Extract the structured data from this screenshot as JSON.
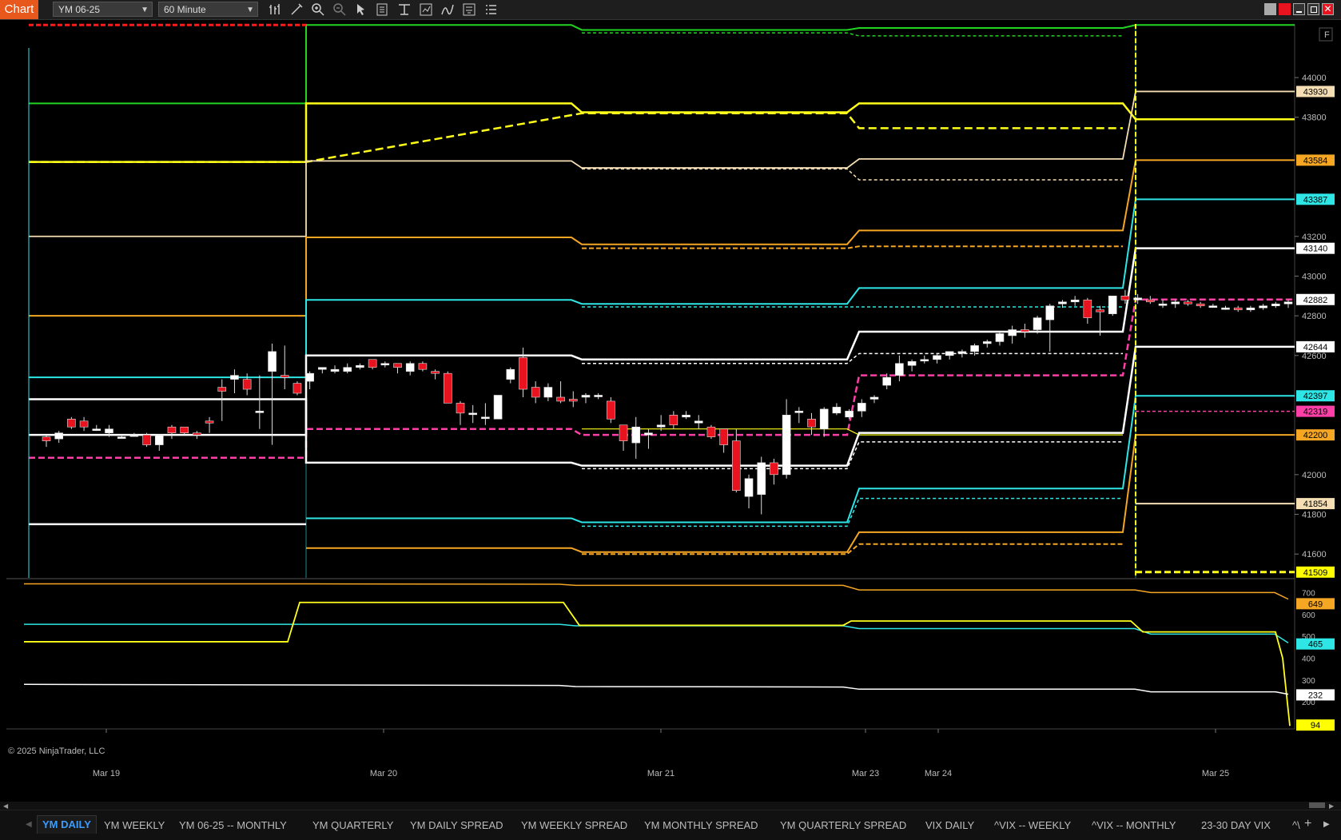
{
  "toolbar": {
    "title": "Chart",
    "instrument": "YM 06-25",
    "interval": "60 Minute",
    "icons": [
      "bars-type-icon",
      "draw-icon",
      "zoom-in-icon",
      "zoom-out-icon",
      "pointer-icon",
      "data-box-icon",
      "templates-icon",
      "properties-icon",
      "indicators-icon",
      "strategies-icon",
      "list-icon"
    ]
  },
  "window": {
    "buttons": [
      "restore-icon",
      "color-icon",
      "minimize-icon",
      "maximize-icon",
      "close-icon"
    ]
  },
  "price_axis": {
    "ticks": [
      "44000",
      "43800",
      "43200",
      "43000",
      "42800",
      "42600",
      "42000",
      "41800",
      "41600"
    ],
    "flag": "F",
    "markers": [
      {
        "text": "43930",
        "color": "#f5deb3"
      },
      {
        "text": "43584",
        "color": "#f5a623"
      },
      {
        "text": "43387",
        "color": "#2ee6e6"
      },
      {
        "text": "43140",
        "color": "#ffffff"
      },
      {
        "text": "42882",
        "color": "#ffffff"
      },
      {
        "text": "42644",
        "color": "#ffffff"
      },
      {
        "text": "42397",
        "color": "#2ee6e6"
      },
      {
        "text": "42319",
        "color": "#ff3fa8"
      },
      {
        "text": "42200",
        "color": "#f5a623"
      },
      {
        "text": "41854",
        "color": "#f5deb3"
      },
      {
        "text": "41509",
        "color": "#ffff00"
      }
    ]
  },
  "indicator_axis": {
    "ticks": [
      "700",
      "600",
      "500",
      "400",
      "300",
      "200"
    ],
    "markers": [
      {
        "text": "649",
        "color": "#f5a623"
      },
      {
        "text": "465",
        "color": "#2ee6e6"
      },
      {
        "text": "232",
        "color": "#ffffff"
      },
      {
        "text": "94",
        "color": "#ffff00"
      }
    ]
  },
  "time_axis": [
    "Mar 19",
    "Mar 20",
    "Mar 21",
    "Mar 23",
    "Mar 24",
    "Mar 25"
  ],
  "copyright": "© 2025 NinjaTrader, LLC",
  "tabs": [
    "YM DAILY",
    "YM WEEKLY",
    "YM 06-25 -- MONTHLY",
    "YM QUARTERLY",
    "YM DAILY SPREAD",
    "YM WEEKLY SPREAD",
    "YM MONTHLY SPREAD",
    "YM QUARTERLY SPREAD",
    "VIX DAILY",
    "^VIX -- WEEKLY",
    "^VIX -- MONTHLY",
    "23-30 DAY VIX",
    "^\\"
  ],
  "colors": {
    "bull": "#ffffff",
    "bear": "#e8131f",
    "green": "#22d422",
    "yellow": "#ffff1a",
    "tan": "#f5deb3",
    "orange": "#f5a623",
    "cyan": "#2ee6e6",
    "pink": "#ff3fa8",
    "red": "#ff1a1a"
  },
  "chart_data": {
    "type": "candlestick",
    "symbol": "YM 06-25",
    "interval": "60 Minute",
    "ylim": [
      41480,
      44270
    ],
    "candles": [
      [
        42190,
        42200,
        42140,
        42170
      ],
      [
        42180,
        42220,
        42160,
        42210
      ],
      [
        42280,
        42290,
        42230,
        42240
      ],
      [
        42270,
        42290,
        42220,
        42240
      ],
      [
        42230,
        42250,
        42220,
        42230
      ],
      [
        42210,
        42250,
        42190,
        42230
      ],
      [
        42190,
        42200,
        42180,
        42190
      ],
      [
        42200,
        42210,
        42200,
        42200
      ],
      [
        42200,
        42210,
        42140,
        42150
      ],
      [
        42150,
        42190,
        42120,
        42200
      ],
      [
        42240,
        42250,
        42180,
        42210
      ],
      [
        42240,
        42240,
        42200,
        42210
      ],
      [
        42210,
        42220,
        42180,
        42200
      ],
      [
        42270,
        42290,
        42210,
        42260
      ],
      [
        42440,
        42480,
        42270,
        42420
      ],
      [
        42480,
        42530,
        42410,
        42500
      ],
      [
        42480,
        42510,
        42400,
        42430
      ],
      [
        42320,
        42500,
        42230,
        42320
      ],
      [
        42520,
        42660,
        42150,
        42620
      ],
      [
        42500,
        42650,
        42430,
        42490
      ],
      [
        42460,
        42470,
        42400,
        42410
      ],
      [
        42470,
        42520,
        42430,
        42510
      ],
      [
        42530,
        42540,
        42510,
        42540
      ],
      [
        42520,
        42550,
        42510,
        42530
      ],
      [
        42520,
        42560,
        42510,
        42540
      ],
      [
        42540,
        42560,
        42530,
        42550
      ],
      [
        42580,
        42580,
        42530,
        42540
      ],
      [
        42560,
        42570,
        42540,
        42560
      ],
      [
        42560,
        42560,
        42510,
        42540
      ],
      [
        42520,
        42570,
        42500,
        42560
      ],
      [
        42560,
        42570,
        42520,
        42530
      ],
      [
        42520,
        42530,
        42480,
        42510
      ],
      [
        42510,
        42520,
        42460,
        42360
      ],
      [
        42360,
        42370,
        42250,
        42310
      ],
      [
        42310,
        42350,
        42260,
        42310
      ],
      [
        42290,
        42360,
        42250,
        42290
      ],
      [
        42280,
        42400,
        42280,
        42400
      ],
      [
        42480,
        42540,
        42460,
        42530
      ],
      [
        42590,
        42640,
        42390,
        42430
      ],
      [
        42440,
        42470,
        42360,
        42390
      ],
      [
        42390,
        42460,
        42370,
        42440
      ],
      [
        42390,
        42470,
        42360,
        42370
      ],
      [
        42380,
        42420,
        42340,
        42370
      ],
      [
        42390,
        42410,
        42360,
        42400
      ],
      [
        42400,
        42410,
        42380,
        42400
      ],
      [
        42370,
        42390,
        42260,
        42280
      ],
      [
        42250,
        42250,
        42120,
        42170
      ],
      [
        42160,
        42290,
        42080,
        42240
      ],
      [
        42200,
        42230,
        42130,
        42210
      ],
      [
        42240,
        42300,
        42220,
        42250
      ],
      [
        42300,
        42320,
        42230,
        42250
      ],
      [
        42290,
        42320,
        42280,
        42300
      ],
      [
        42260,
        42300,
        42230,
        42270
      ],
      [
        42240,
        42250,
        42180,
        42190
      ],
      [
        42230,
        42230,
        42110,
        42150
      ],
      [
        42170,
        42230,
        41910,
        41920
      ],
      [
        41890,
        42000,
        41830,
        41980
      ],
      [
        41900,
        42090,
        41800,
        42060
      ],
      [
        42060,
        42080,
        41950,
        42000
      ],
      [
        42000,
        42380,
        41980,
        42300
      ],
      [
        42320,
        42340,
        42260,
        42320
      ],
      [
        42280,
        42310,
        42200,
        42240
      ],
      [
        42230,
        42340,
        42190,
        42330
      ],
      [
        42310,
        42360,
        42300,
        42340
      ],
      [
        42290,
        42330,
        42280,
        42320
      ],
      [
        42320,
        42380,
        42290,
        42360
      ],
      [
        42380,
        42400,
        42360,
        42390
      ],
      [
        42450,
        42510,
        42430,
        42490
      ],
      [
        42500,
        42600,
        42470,
        42560
      ],
      [
        42550,
        42580,
        42520,
        42570
      ],
      [
        42580,
        42600,
        42560,
        42580
      ],
      [
        42580,
        42610,
        42560,
        42600
      ],
      [
        42600,
        42620,
        42580,
        42620
      ],
      [
        42610,
        42630,
        42590,
        42620
      ],
      [
        42620,
        42660,
        42600,
        42650
      ],
      [
        42660,
        42680,
        42640,
        42670
      ],
      [
        42670,
        42720,
        42650,
        42710
      ],
      [
        42700,
        42750,
        42660,
        42730
      ],
      [
        42730,
        42760,
        42690,
        42720
      ],
      [
        42730,
        42800,
        42710,
        42790
      ],
      [
        42780,
        42860,
        42620,
        42850
      ],
      [
        42860,
        42880,
        42840,
        42870
      ],
      [
        42870,
        42900,
        42850,
        42880
      ],
      [
        42880,
        42890,
        42760,
        42790
      ],
      [
        42830,
        42850,
        42700,
        42820
      ],
      [
        42810,
        42900,
        42800,
        42900
      ],
      [
        42900,
        42930,
        42860,
        42880
      ],
      [
        42880,
        42910,
        42860,
        42890
      ],
      [
        42880,
        42900,
        42860,
        42870
      ],
      [
        42860,
        42880,
        42840,
        42860
      ],
      [
        42860,
        42880,
        42840,
        42870
      ],
      [
        42870,
        42880,
        42850,
        42860
      ],
      [
        42860,
        42870,
        42840,
        42850
      ],
      [
        42850,
        42860,
        42840,
        42850
      ],
      [
        42840,
        42850,
        42830,
        42840
      ],
      [
        42840,
        42850,
        42820,
        42830
      ],
      [
        42830,
        42850,
        42820,
        42840
      ],
      [
        42840,
        42860,
        42830,
        42850
      ],
      [
        42850,
        42870,
        42840,
        42860
      ],
      [
        42860,
        42880,
        42840,
        42870
      ]
    ],
    "levels": {
      "green": 44000,
      "yellow": 43800,
      "tan": 43560,
      "orange": 43180,
      "cyan": 42880,
      "white_high": 42650,
      "pink": 42600,
      "white_low": 42090,
      "cyan_low": 41750,
      "orange_low": 41600
    },
    "indicator": {
      "series": [
        {
          "color": "orange",
          "last": 649
        },
        {
          "color": "cyan",
          "last": 465
        },
        {
          "color": "white",
          "last": 232
        },
        {
          "color": "yellow",
          "last": 94
        }
      ],
      "ylim": [
        80,
        760
      ]
    },
    "xlabel": "",
    "ylabel": ""
  }
}
